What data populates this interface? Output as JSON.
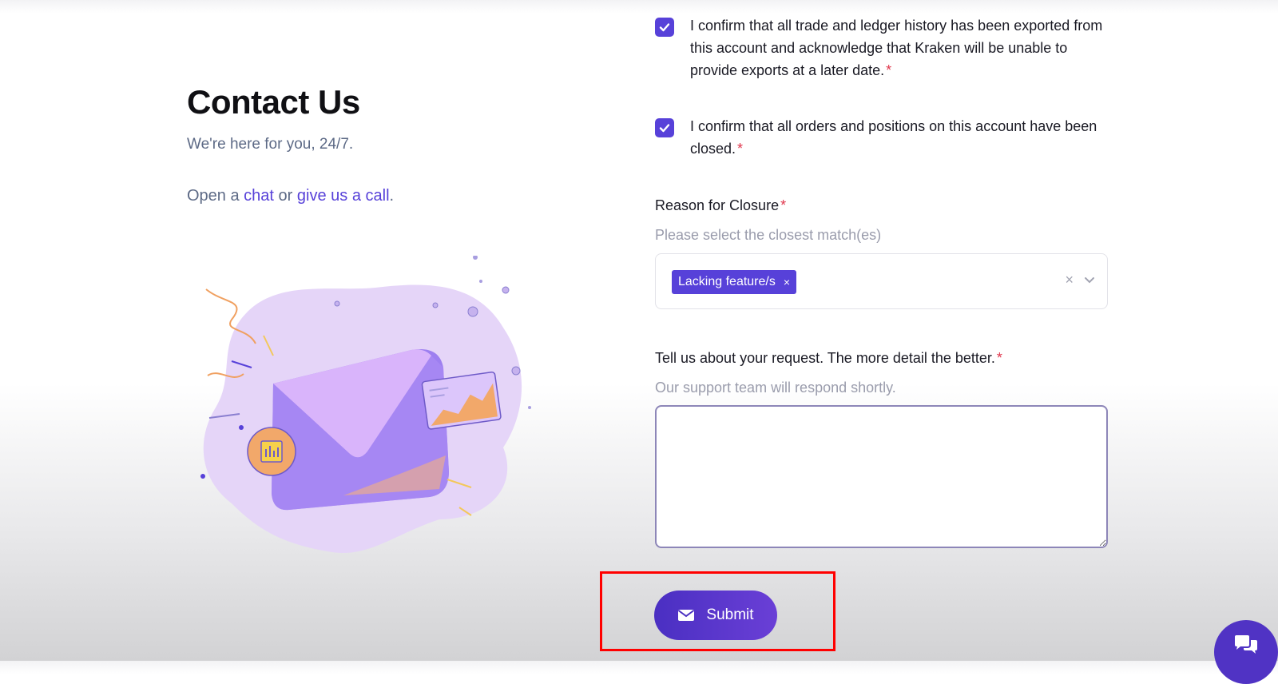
{
  "header": {
    "title": "Contact Us",
    "subtitle": "We're here for you, 24/7.",
    "contact": {
      "prefix": "Open a ",
      "chat_link": "chat",
      "middle": " or ",
      "call_link": "give us a call",
      "suffix": "."
    }
  },
  "form": {
    "confirm_exports": {
      "label": "I confirm that all trade and ledger history has been exported from this account and acknowledge that Kraken will be unable to provide exports at a later date.",
      "checked": true
    },
    "confirm_closed": {
      "label": "I confirm that all orders and positions on this account have been closed.",
      "checked": true
    },
    "required_marker": "*",
    "reason": {
      "label": "Reason for Closure",
      "help": "Please select the closest match(es)",
      "selected_tag": "Lacking feature/s",
      "tag_remove": "×",
      "clear": "×"
    },
    "request": {
      "label": "Tell us about your request. The more detail the better.",
      "help": "Our support team will respond shortly.",
      "value": ""
    },
    "submit_label": "Submit"
  },
  "colors": {
    "accent": "#5741d9",
    "required": "#e0364c",
    "highlight": "#ff0000"
  },
  "icons": [
    "check-icon",
    "envelope-icon",
    "chevron-down-icon",
    "chat-bubbles-icon"
  ]
}
